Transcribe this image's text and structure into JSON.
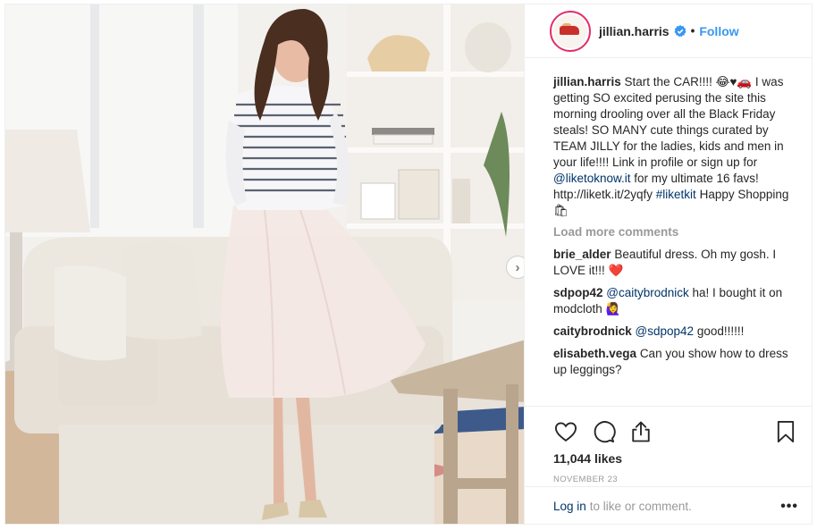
{
  "post": {
    "username": "jillian.harris",
    "follow_label": "Follow",
    "dot": "•",
    "caption": {
      "username": "jillian.harris",
      "text_1": "Start the CAR!!!! 😂♥🚗 I was getting SO excited perusing the site this morning drooling over all the Black Friday steals! SO MANY cute things curated by TEAM JILLY for the ladies, kids and men in your life!!!! Link in profile or sign up for ",
      "mention": "@liketoknow.it",
      "text_2": " for my ultimate 16 favs! http://liketk.it/2yqfy ",
      "hashtag": "#liketkit",
      "text_3": " Happy Shopping 🛍"
    },
    "load_more_label": "Load more comments",
    "comments": [
      {
        "username": "brie_alder",
        "text": "Beautiful dress. Oh my gosh. I LOVE it!!! ❤️"
      },
      {
        "username": "sdpop42",
        "mention": "@caitybrodnick",
        "text": " ha! I bought it on modcloth 🙋‍♀️"
      },
      {
        "username": "caitybrodnick",
        "mention": "@sdpop42",
        "text": " good!!!!!!"
      },
      {
        "username": "elisabeth.vega",
        "text": "Can you show how to dress up leggings?"
      }
    ],
    "likes": "11,044 likes",
    "date": "NOVEMBER 23",
    "login_link": "Log in",
    "login_rest": "to like or comment.",
    "more_options": "•••",
    "carousel_next": "›"
  },
  "icons": {
    "like": "heart-icon",
    "comment": "comment-icon",
    "share": "share-icon",
    "save": "bookmark-icon",
    "verified": "verified-badge-icon"
  },
  "colors": {
    "follow": "#3897f0",
    "link": "#003569",
    "muted": "#999999",
    "story_ring": "#e1306c"
  }
}
